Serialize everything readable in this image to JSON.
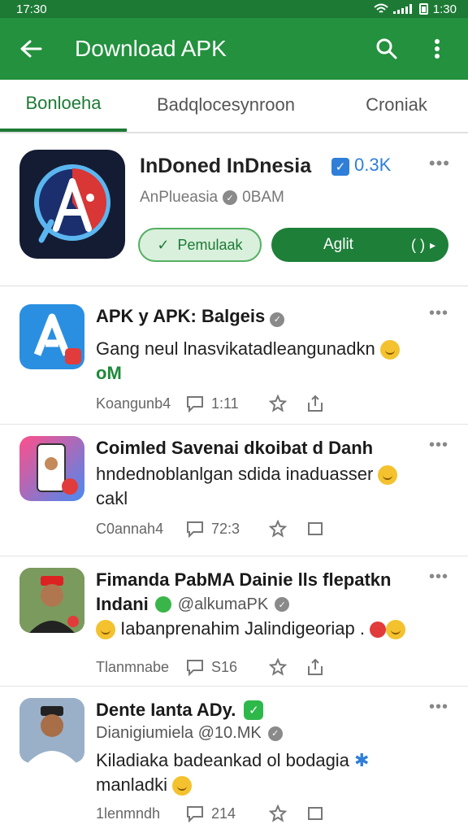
{
  "status_bar": {
    "time_left": "17:30",
    "time_right": "1:30"
  },
  "app_bar": {
    "title": "Download APK"
  },
  "tabs": [
    {
      "label": "Bonloeha",
      "active": true
    },
    {
      "label": "Badqlocesynroon",
      "active": false
    },
    {
      "label": "Croniak",
      "active": false
    }
  ],
  "featured": {
    "name": "InDoned InDnesia",
    "count": "0.3K",
    "subtitle": "AnPlueasia",
    "time": "0BAM",
    "btn_primary": "Pemulaak",
    "btn_secondary": "Aglit",
    "btn_secondary_extra": "( )"
  },
  "posts": [
    {
      "title": "APK y APK: Balgeis",
      "body": "Gang neul lnasvikatadleangunadkn",
      "tag": "oM",
      "author": "Koangunb4",
      "comments": "1:11"
    },
    {
      "title": "Coimled Savenai dkoibat d Danh",
      "body": "hndednoblanlgan sdida inaduasser",
      "body2": "cakl",
      "author": "C0annah4",
      "comments": "72:3"
    },
    {
      "title": "Fimanda PabMA Dainie lls flepatkn",
      "title2": "Indani",
      "handle": "@alkumaPK",
      "body": "Iabanprenahim Jalindigeoriap .",
      "author": "Tlanmnabe",
      "comments": "S16"
    },
    {
      "title": "Dente Ianta ADy.",
      "subtitle": "Dianigiumiela @10.MK",
      "body": "Kiladiaka badeankad ol bodagia",
      "body2": "manladki",
      "author": "1lenmndh",
      "comments": "214"
    }
  ],
  "colors": {
    "primary": "#23913e",
    "status": "#1d7a35",
    "accent_blue": "#2f7fd8"
  },
  "icons": [
    "back-arrow-icon",
    "search-icon",
    "overflow-menu-icon",
    "check-icon",
    "comment-icon",
    "star-icon",
    "share-icon"
  ]
}
